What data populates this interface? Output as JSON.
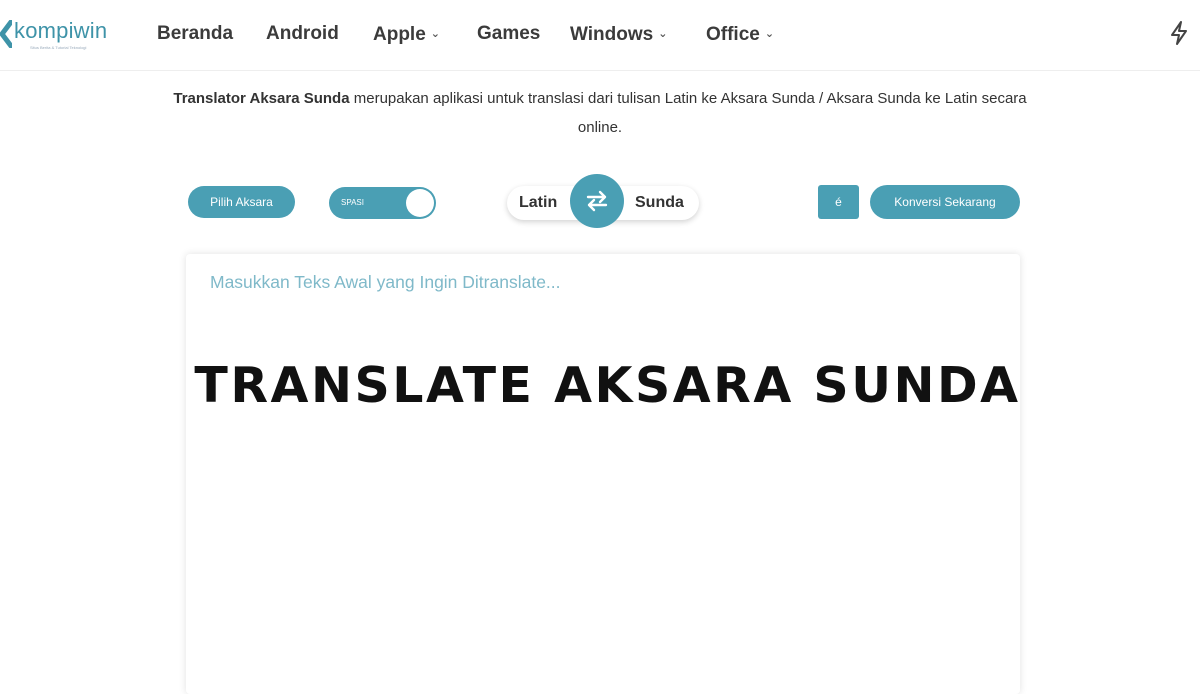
{
  "brand": {
    "name": "kompiwin",
    "tagline": "Situs Berita & Tutorial Teknologi",
    "accent_color": "#4a9fb4"
  },
  "nav": {
    "items": [
      {
        "label": "Beranda",
        "has_dropdown": false
      },
      {
        "label": "Android",
        "has_dropdown": false
      },
      {
        "label": "Apple",
        "has_dropdown": true
      },
      {
        "label": "Games",
        "has_dropdown": false
      },
      {
        "label": "Windows",
        "has_dropdown": true
      },
      {
        "label": "Office",
        "has_dropdown": true
      }
    ],
    "dropdown_icon": "chevron-down-icon",
    "right_icon": "lightning-icon"
  },
  "intro": {
    "bold": "Translator Aksara Sunda",
    "rest": " merupakan aplikasi untuk translasi dari tulisan Latin ke Aksara Sunda / Aksara Sunda ke Latin secara online."
  },
  "controls": {
    "pilih_aksara": "Pilih Aksara",
    "spasi_toggle": "SPASI",
    "lang_from": "Latin",
    "lang_to": "Sunda",
    "swap_icon": "swap-arrows-icon",
    "special_char": "é",
    "convert": "Konversi Sekarang"
  },
  "editor": {
    "placeholder": "Masukkan Teks Awal yang Ingin Ditranslate..."
  },
  "overlay": {
    "title": "TRANSLATE AKSARA SUNDA"
  }
}
